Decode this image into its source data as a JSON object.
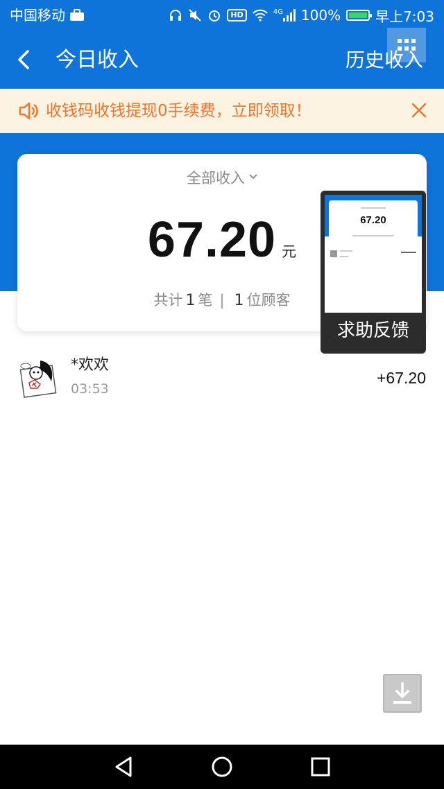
{
  "status_bar": {
    "carrier": "中国移动",
    "icons": [
      "briefcase-icon",
      "headset-icon",
      "mute-icon",
      "alarm-icon",
      "hd-icon",
      "wifi-icon",
      "signal-icon",
      "battery-icon"
    ],
    "hd": "HD",
    "network": "4G",
    "battery": "100%",
    "battery_level": 1.0,
    "time": "早上7:03"
  },
  "nav": {
    "title": "今日收入",
    "history": "历史收入",
    "bar_color": "#0e74d9"
  },
  "notice": {
    "text": "收钱码收钱提现0手续费，立即领取！",
    "color": "#f0742a",
    "background": "#fdf3e3"
  },
  "summary": {
    "filter_label": "全部收入",
    "amount": "67.20",
    "unit": "元",
    "stats_prefix": "共计",
    "count": "1",
    "count_unit": "笔",
    "customers": "1",
    "customers_unit": "位顾客"
  },
  "transactions": [
    {
      "name": "*欢欢",
      "time": "03:53",
      "amount": "+67.20"
    }
  ],
  "feedback_popup": {
    "label": "求助反馈",
    "thumb_amount": "67.20"
  }
}
